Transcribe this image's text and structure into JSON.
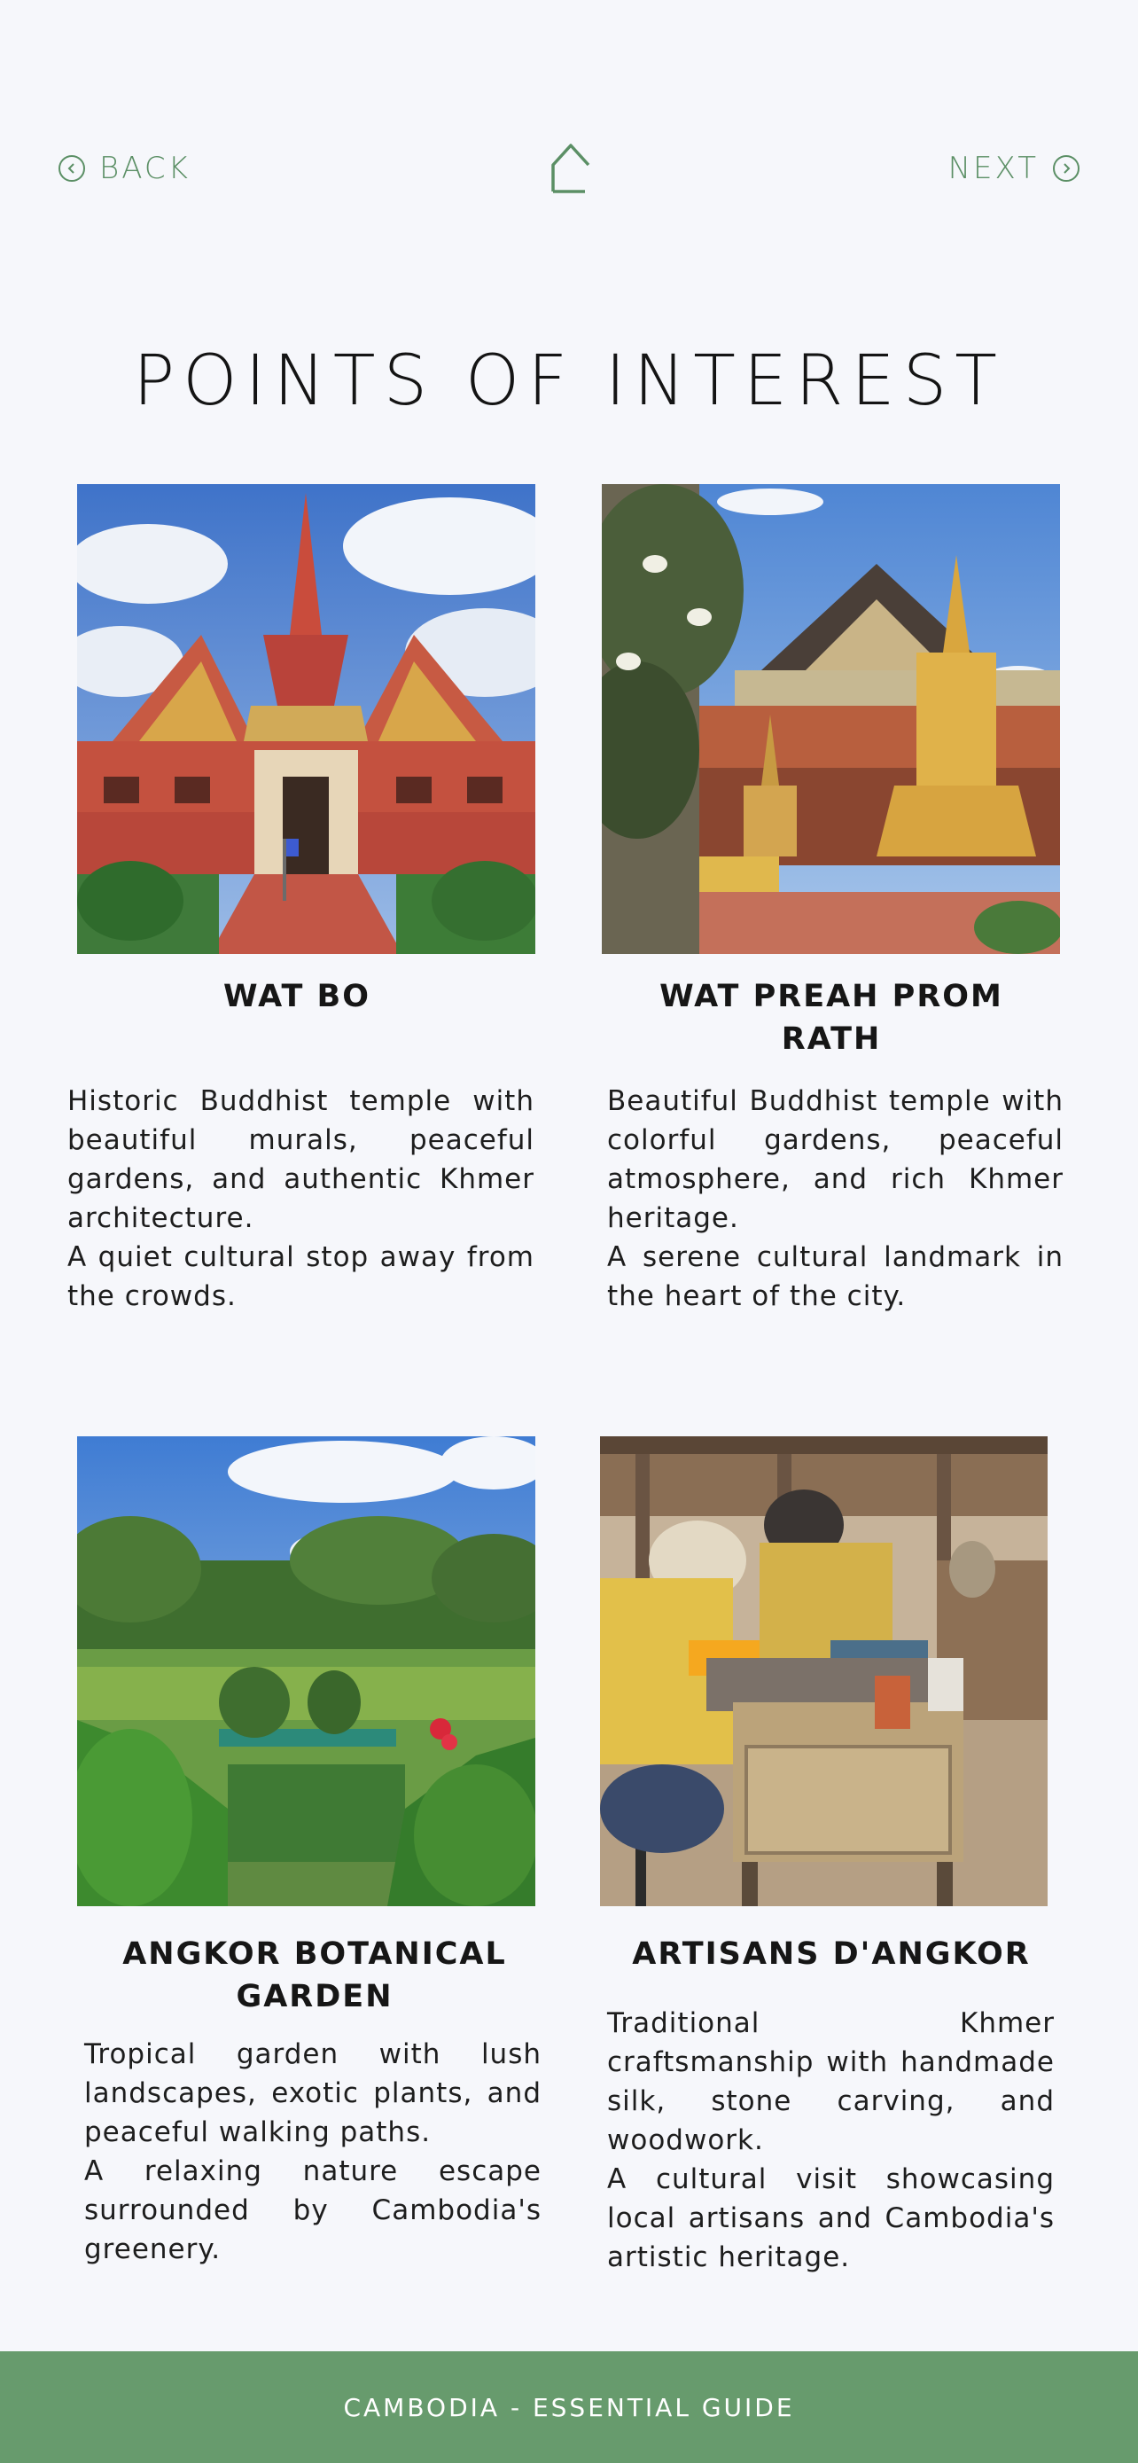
{
  "nav": {
    "back_label": "BACK",
    "next_label": "NEXT"
  },
  "page_title": "POINTS OF INTEREST",
  "cards": [
    {
      "title": "WAT BO",
      "paragraph1": "Historic Buddhist temple with beautiful murals, peaceful gardens, and authentic Khmer architecture.",
      "paragraph2": "A quiet cultural stop away from the crowds."
    },
    {
      "title": "WAT PREAH PROM RATH",
      "paragraph1": "Beautiful Buddhist temple with colorful gardens, peaceful atmosphere, and rich Khmer heritage.",
      "paragraph2": "A serene cultural landmark in the heart of the city."
    },
    {
      "title": "ANGKOR BOTANICAL GARDEN",
      "paragraph1": "Tropical garden with lush landscapes, exotic plants, and peaceful walking paths.",
      "paragraph2": "A relaxing nature escape surrounded by Cambodia's greenery."
    },
    {
      "title": "ARTISANS D'ANGKOR",
      "paragraph1": "Traditional Khmer craftsmanship with handmade silk, stone carving, and woodwork.",
      "paragraph2": "A cultural visit showcasing local artisans and Cambodia's artistic heritage."
    }
  ],
  "footer": {
    "text": "CAMBODIA - ESSENTIAL GUIDE"
  },
  "colors": {
    "accent_green": "#5b8f65",
    "footer_green": "#679b6d",
    "background": "#f6f7fb"
  },
  "icons": {
    "back": "chevron-left-circle-icon",
    "home": "home-icon",
    "next": "chevron-right-circle-icon"
  }
}
